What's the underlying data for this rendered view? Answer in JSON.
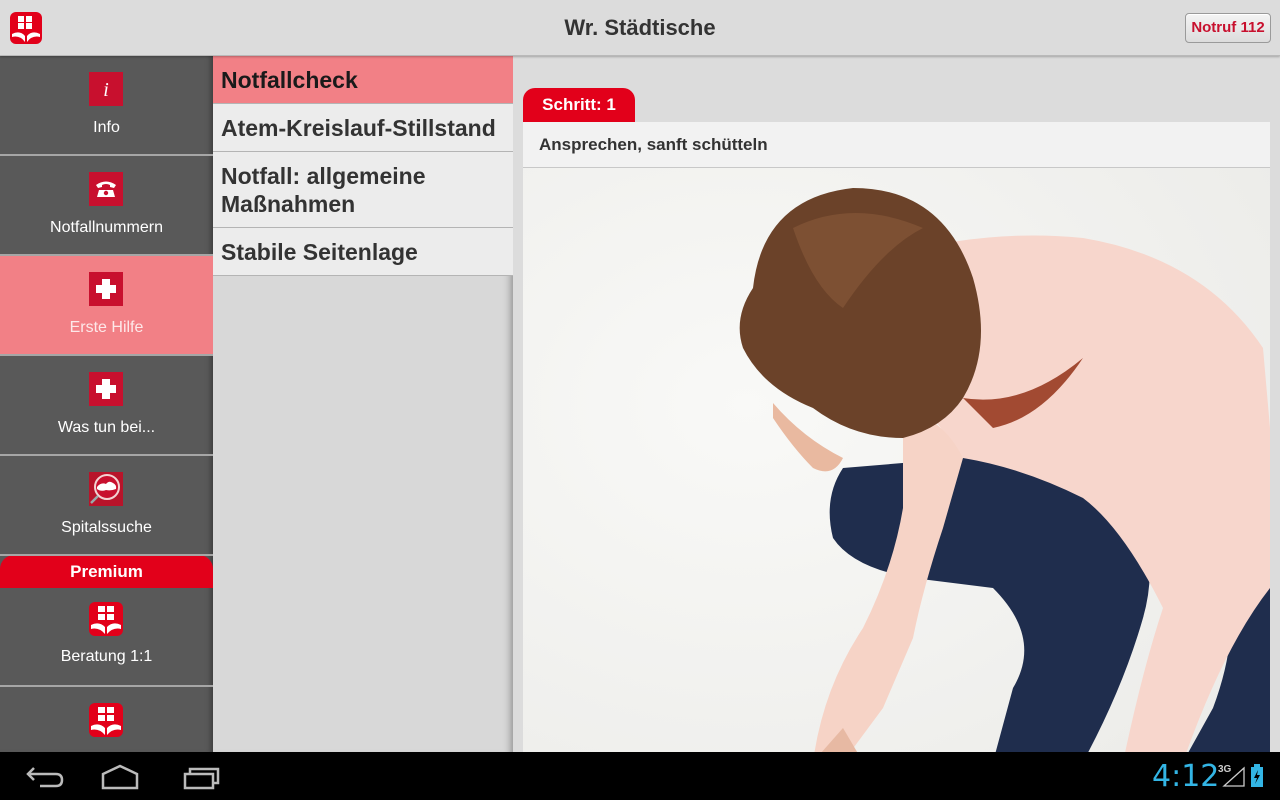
{
  "app": {
    "title": "Wr. Städtische",
    "emergency_button": "Notruf 112",
    "brand_color": "#e2001a",
    "active_color": "#f28086"
  },
  "nav": {
    "items": [
      {
        "label": "Info",
        "icon": "info-icon",
        "active": false
      },
      {
        "label": "Notfallnummern",
        "icon": "phone-icon",
        "active": false
      },
      {
        "label": "Erste Hilfe",
        "icon": "first-aid-cross-icon",
        "active": true
      },
      {
        "label": "Was tun bei...",
        "icon": "first-aid-cross-icon",
        "active": false
      },
      {
        "label": "Spitalssuche",
        "icon": "hospital-search-icon",
        "active": false
      }
    ],
    "premium_header": "Premium",
    "premium_items": [
      {
        "label": "Beratung 1:1",
        "icon": "wst-logo-icon"
      },
      {
        "label": "",
        "icon": "wst-logo-icon"
      }
    ]
  },
  "sublist": {
    "items": [
      {
        "label": "Notfallcheck",
        "active": true
      },
      {
        "label": "Atem-Kreislauf-Stillstand",
        "active": false
      },
      {
        "label": "Notfall: allgemeine Maßnahmen",
        "active": false
      },
      {
        "label": "Stabile Seitenlage",
        "active": false
      }
    ]
  },
  "content": {
    "step_label": "Schritt: 1",
    "step_text": "Ansprechen, sanft schütteln",
    "image_alt": "Frau kniet und beugt sich nach vorne"
  },
  "system": {
    "time": "4:12",
    "network": "3G",
    "nav_buttons": [
      "back",
      "home",
      "recent-apps"
    ]
  }
}
